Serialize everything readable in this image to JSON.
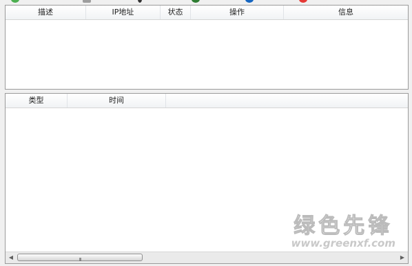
{
  "top_table": {
    "columns": [
      "描述",
      "IP地址",
      "状态",
      "操作",
      "信息"
    ]
  },
  "bottom_table": {
    "columns": [
      "类型",
      "时间"
    ]
  },
  "scrollbar": {
    "grip": "III"
  },
  "watermark": {
    "brand_cn": "绿色先锋",
    "url": "www.greenxf.com"
  },
  "colors": {
    "toolbar_icons": [
      "#4caf50",
      "#2e7d32",
      "#1565c0",
      "#e53935"
    ]
  }
}
